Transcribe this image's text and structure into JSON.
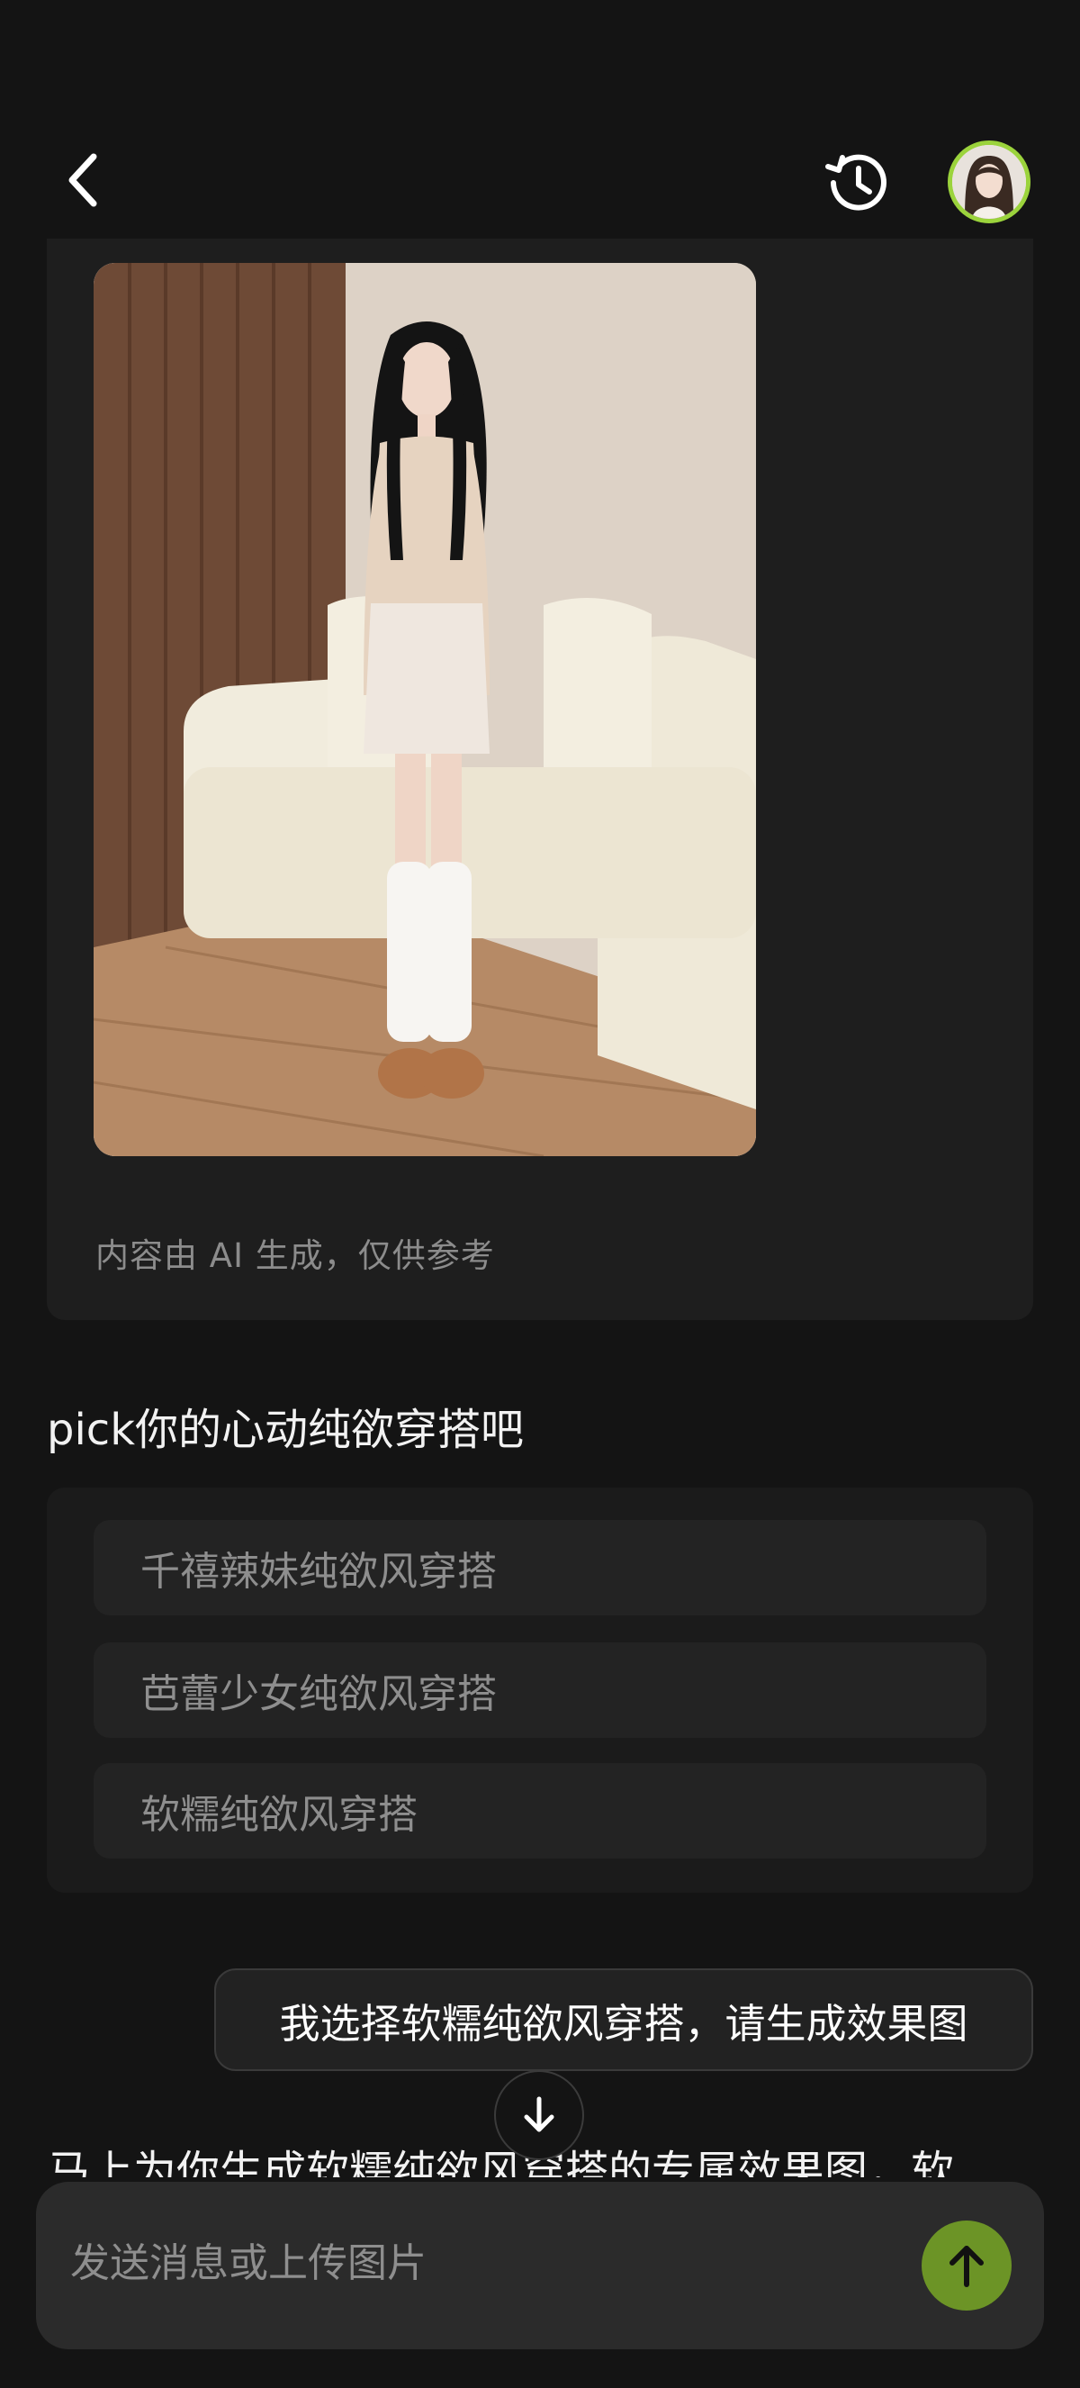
{
  "header": {
    "back_icon": "chevron-left-icon",
    "history_icon": "history-clock-icon",
    "avatar_icon": "user-avatar"
  },
  "image_card": {
    "ai_note": "内容由 AI 生成，仅供参考"
  },
  "prompt": "pick你的心动纯欲穿搭吧",
  "options": [
    {
      "label": "千禧辣妹纯欲风穿搭"
    },
    {
      "label": "芭蕾少女纯欲风穿搭"
    },
    {
      "label": "软糯纯欲风穿搭"
    }
  ],
  "user_message": "我选择软糯纯欲风穿搭，请生成效果图",
  "reply_partial": "马上为你生成软糯纯欲风穿搭的专属效果图，软",
  "input": {
    "placeholder": "发送消息或上传图片",
    "value": ""
  },
  "colors": {
    "background": "#141414",
    "card": "#1e1e1e",
    "accent_green": "#6c9426",
    "avatar_ring": "#9bd33c"
  }
}
